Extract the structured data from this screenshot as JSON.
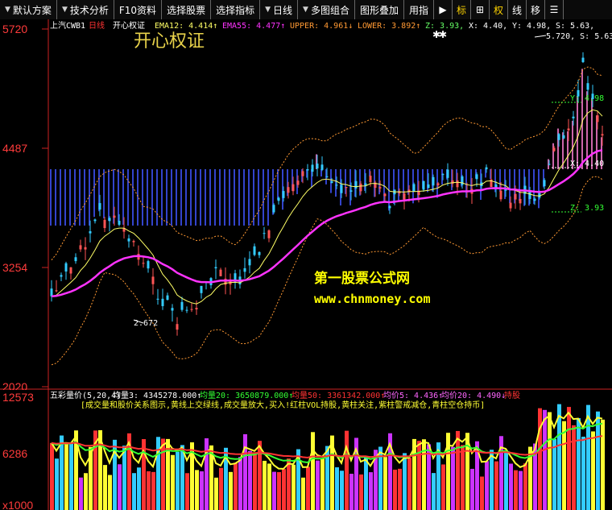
{
  "toolbar": {
    "items": [
      {
        "label": "默认方案",
        "dropdown": true
      },
      {
        "label": "技术分析",
        "dropdown": true
      },
      {
        "label": "F10资料",
        "dropdown": false
      },
      {
        "label": "选择股票",
        "dropdown": false
      },
      {
        "label": "选择指标",
        "dropdown": false
      },
      {
        "label": "日线",
        "dropdown": true
      },
      {
        "label": "多图组合",
        "dropdown": true
      },
      {
        "label": "图形叠加",
        "dropdown": false
      },
      {
        "label": "用指",
        "dropdown": false
      }
    ],
    "right_buttons": [
      "▶",
      "标",
      "⊞",
      "权",
      "线",
      "移",
      "☰"
    ]
  },
  "main_chart": {
    "stock_name": "上汽CWB1",
    "period": "日线",
    "indicator_name": "开心权证",
    "big_title": "开心权证",
    "legend": [
      {
        "label": "EMA12: 4.414↑",
        "color": "#ffff66"
      },
      {
        "label": "EMA55: 4.477↑",
        "color": "#ff33ff"
      },
      {
        "label": "UPPER: 4.961↓",
        "color": "#ff9933"
      },
      {
        "label": "LOWER: 3.892↑",
        "color": "#ff9933"
      },
      {
        "label": "Z: 3.93,",
        "color": "#66ff66"
      },
      {
        "label": "X: 4.40,",
        "color": "#ffffff"
      },
      {
        "label": "Y: 4.98,",
        "color": "#ffffff"
      },
      {
        "label": "S: 5.63,",
        "color": "#ffffff"
      }
    ],
    "y_ticks": [
      "5720",
      "4487",
      "3254",
      "2020"
    ],
    "annotations": {
      "high": "5.720, S: 5.63",
      "low": "2.672",
      "y_label": "Y: 4.98",
      "x_label": "X: 4.40",
      "z_label": "Z: 3.93"
    },
    "watermark_title": "第一股票公式网",
    "watermark_url": "www.chnmoney.com",
    "colors": {
      "ema12": "#ffff66",
      "ema55": "#ff33ff",
      "band": "#ff9933",
      "up": "#ff5555",
      "down": "#33ccff"
    }
  },
  "vol_chart": {
    "legend": [
      {
        "label": "五彩量价(5,20,4)",
        "color": "#ffffff"
      },
      {
        "label": "均量3: 4345278.000↑",
        "color": "#ffffff"
      },
      {
        "label": "均量20: 3650879.000↑",
        "color": "#33ff33"
      },
      {
        "label": "均量50: 3361342.000↑",
        "color": "#ff3333"
      },
      {
        "label": "均价5: 4.436↑",
        "color": "#ff66ff"
      },
      {
        "label": "均价20: 4.490↓",
        "color": "#ff66ff"
      },
      {
        "label": "持股",
        "color": "#ff3333"
      }
    ],
    "note": "[成交量和股价关系图示,黄线上交绿线,成交量放大,买入!红柱VOL持股,黄柱关注,紫柱警戒减仓,青柱空仓持币]",
    "y_ticks": [
      "12573",
      "6286",
      "x1000"
    ]
  }
}
